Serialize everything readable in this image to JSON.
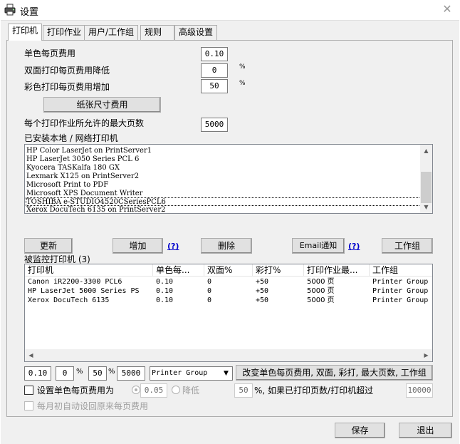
{
  "window": {
    "title": "设置",
    "close_glyph": "✕"
  },
  "tabs": [
    {
      "label": "打印机",
      "active": true
    },
    {
      "label": "打印作业"
    },
    {
      "label": "用户/工作组"
    },
    {
      "label": "规则"
    },
    {
      "label": "高级设置"
    }
  ],
  "costs": {
    "mono_label": "单色每页费用",
    "mono_value": "0.10",
    "duplex_label": "双面打印每页费用降低",
    "duplex_value": "0",
    "duplex_unit": "%",
    "color_label": "彩色打印每页费用增加",
    "color_value": "50",
    "color_unit": "%",
    "paper_size_button": "纸张尺寸费用",
    "max_pages_label": "每个打印作业所允许的最大页数",
    "max_pages_value": "5000"
  },
  "installed": {
    "label": "已安装本地 / 网络打印机",
    "printers": [
      "HP Color LaserJet on PrintServer1",
      "HP LaserJet 3050 Series PCL 6",
      "Kyocera TASKalfa 180 GX",
      "Lexmark X125 on PrintServer2",
      "Microsoft Print to PDF",
      "Microsoft XPS Document Writer",
      "TOSHIBA e-STUDIO4520CSeriesPCL6",
      "Xerox DocuTech 6135 on PrintServer2"
    ]
  },
  "actions": {
    "refresh": "更新",
    "add": "增加",
    "help1": "(?)",
    "delete": "删除",
    "email": "Email通知",
    "help2": "(?)",
    "workgroup": "工作组"
  },
  "monitored": {
    "label": "被监控打印机 (3)",
    "columns": [
      "打印机",
      "单色每...",
      "双面%",
      "彩打%",
      "打印作业最...",
      "工作组"
    ],
    "rows": [
      [
        "Canon iR2200-3300 PCL6",
        "0.10",
        "0",
        "+50",
        "5000 页",
        "Printer Group"
      ],
      [
        "HP LaserJet 5000 Series PS",
        "0.10",
        "0",
        "+50",
        "5000 页",
        "Printer Group"
      ],
      [
        "Xerox DocuTech 6135",
        "0.10",
        "0",
        "+50",
        "5000 页",
        "Printer Group"
      ]
    ]
  },
  "edit": {
    "mono": "0.10",
    "duplex": "0",
    "pct1": "%",
    "color": "50",
    "pct2": "%",
    "max_pages": "5000",
    "group": "Printer Group",
    "apply_button": "改变单色每页费用, 双面, 彩打, 最大页数, 工作组"
  },
  "set_mono": {
    "label": "设置单色每页费用为",
    "value": "0.05",
    "decrease_label": "降低",
    "percent_value": "50",
    "condition": "%, 如果已打印页数/打印机超过",
    "threshold": "10000"
  },
  "monthly": {
    "label": "每月初自动设回原来每页费用"
  },
  "footer": {
    "save": "保存",
    "exit": "退出"
  }
}
